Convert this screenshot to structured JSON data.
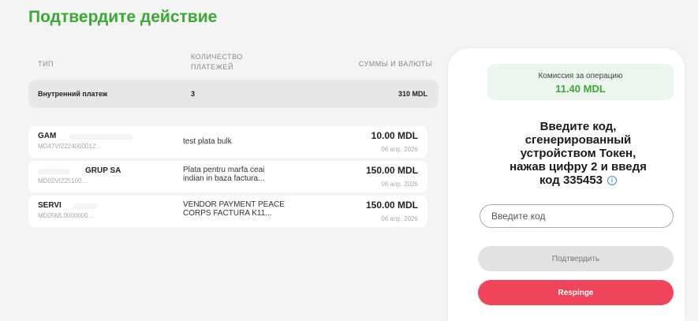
{
  "page": {
    "title": "Подтвердите действие"
  },
  "summary": {
    "headers": {
      "type": "ТИП",
      "count_line1": "КОЛИЧЕСТВО",
      "count_line2": "ПЛАТЕЖЕЙ",
      "sum": "СУММЫ И ВАЛЮТЫ"
    },
    "row": {
      "type": "Внутренний платеж",
      "count": "3",
      "sum": "310 MDL"
    }
  },
  "payments": [
    {
      "name": "GAM",
      "account": "MD47VI2224000012…",
      "desc_line1": "test plata bulk",
      "desc_line2": "",
      "amount": "10.00 MDL",
      "date": "06 апр. 2026"
    },
    {
      "name": "GRUP SA",
      "account": "MD02VI225100…",
      "desc_line1": "Plata pentru marfa ceai",
      "desc_line2": "indian in baza factura...",
      "amount": "150.00 MDL",
      "date": "06 апр. 2026"
    },
    {
      "name": "SERVI",
      "account": "MD05ML0000000…",
      "desc_line1": "VENDOR PAYMENT PEACE",
      "desc_line2": "CORPS FACTURA K11...",
      "amount": "150.00 MDL",
      "date": "06 апр. 2026"
    }
  ],
  "side": {
    "fee_label": "Комиссия за операцию",
    "fee_value": "11.40 MDL",
    "prompt_line1": "Введите код,",
    "prompt_line2": "сгенерированный",
    "prompt_line3": "устройством Токен,",
    "prompt_line4": "нажав цифру 2 и введя",
    "prompt_line5": "код 335453",
    "info_icon": "i",
    "code_placeholder": "Введите код",
    "confirm_label": "Подтвердить",
    "reject_label": "Respinge"
  },
  "colors": {
    "accent": "#3aa935",
    "danger": "#f0445a",
    "info": "#4a8fd6"
  }
}
